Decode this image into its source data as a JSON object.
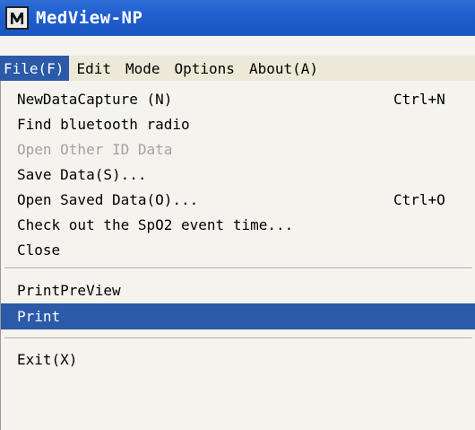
{
  "app": {
    "title": "MedView-NP",
    "icon": "medview-app-icon"
  },
  "menubar": {
    "items": [
      {
        "label": "File(F)",
        "active": true
      },
      {
        "label": "Edit",
        "active": false
      },
      {
        "label": "Mode",
        "active": false
      },
      {
        "label": "Options",
        "active": false
      },
      {
        "label": "About(A)",
        "active": false
      }
    ]
  },
  "file_menu": {
    "items": [
      {
        "label": "NewDataCapture (N)",
        "shortcut": "Ctrl+N",
        "enabled": true,
        "highlighted": false
      },
      {
        "label": "Find bluetooth radio",
        "shortcut": "",
        "enabled": true,
        "highlighted": false
      },
      {
        "label": "Open Other ID Data",
        "shortcut": "",
        "enabled": false,
        "highlighted": false
      },
      {
        "label": "Save Data(S)...",
        "shortcut": "",
        "enabled": true,
        "highlighted": false
      },
      {
        "label": "Open Saved Data(O)...",
        "shortcut": "Ctrl+O",
        "enabled": true,
        "highlighted": false
      },
      {
        "label": "Check out the SpO2 event time...",
        "shortcut": "",
        "enabled": true,
        "highlighted": false
      },
      {
        "label": "Close",
        "shortcut": "",
        "enabled": true,
        "highlighted": false
      },
      {
        "label": "PrintPreView",
        "shortcut": "",
        "enabled": true,
        "highlighted": false
      },
      {
        "label": "Print",
        "shortcut": "",
        "enabled": true,
        "highlighted": true
      },
      {
        "label": "Exit(X)",
        "shortcut": "",
        "enabled": true,
        "highlighted": false
      }
    ]
  },
  "colors": {
    "titlebar": "#1f5fd0",
    "highlight": "#2a5aa8",
    "disabled_text": "#a3a3a3"
  }
}
